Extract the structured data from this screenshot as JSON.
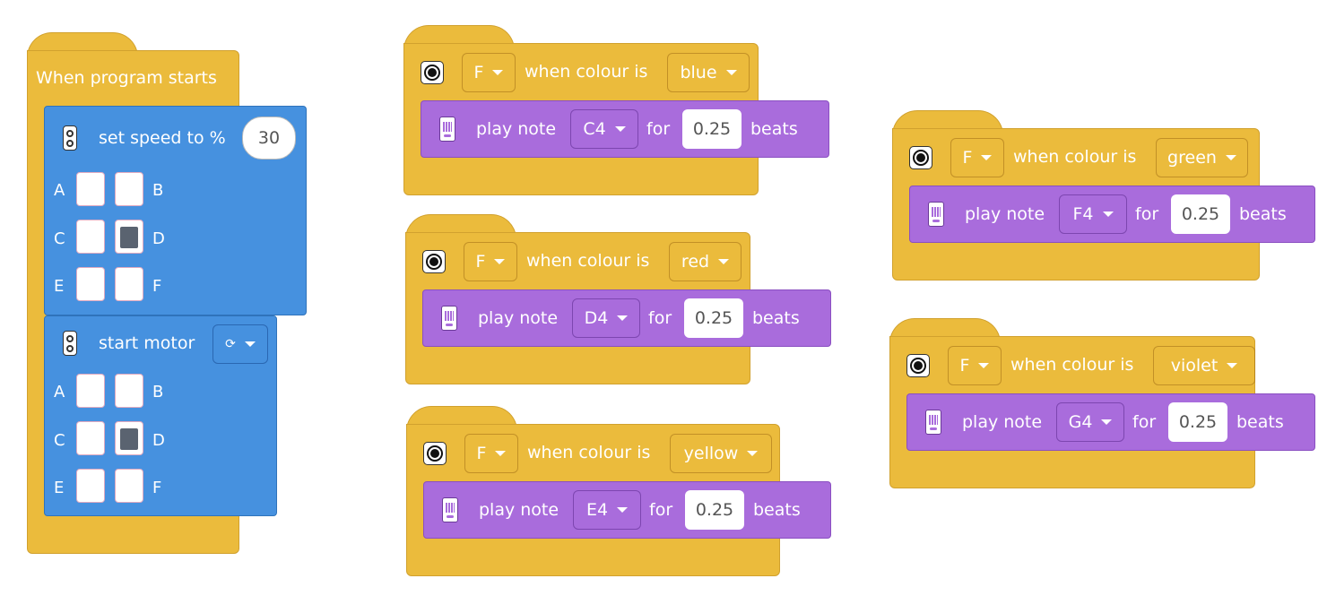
{
  "start_stack": {
    "hat_label": "When program starts",
    "set_speed": {
      "label": "set speed to %",
      "value": "30",
      "ports": [
        [
          "A",
          "B"
        ],
        [
          "C",
          "D"
        ],
        [
          "E",
          "F"
        ]
      ],
      "selected_port": "D"
    },
    "start_motor": {
      "label": "start motor",
      "direction_icon": "⟳",
      "ports": [
        [
          "A",
          "B"
        ],
        [
          "C",
          "D"
        ],
        [
          "E",
          "F"
        ]
      ],
      "selected_port": "D"
    }
  },
  "colour_stacks": [
    {
      "port": "F",
      "when_label": "when colour is",
      "colour": "blue",
      "play_label": "play note",
      "note": "C4",
      "for_label": "for",
      "beats": "0.25",
      "beats_label": "beats"
    },
    {
      "port": "F",
      "when_label": "when colour is",
      "colour": "red",
      "play_label": "play note",
      "note": "D4",
      "for_label": "for",
      "beats": "0.25",
      "beats_label": "beats"
    },
    {
      "port": "F",
      "when_label": "when colour is",
      "colour": "yellow",
      "play_label": "play note",
      "note": "E4",
      "for_label": "for",
      "beats": "0.25",
      "beats_label": "beats"
    },
    {
      "port": "F",
      "when_label": "when colour is",
      "colour": "green",
      "play_label": "play note",
      "note": "F4",
      "for_label": "for",
      "beats": "0.25",
      "beats_label": "beats"
    },
    {
      "port": "F",
      "when_label": "when colour is",
      "colour": "violet",
      "play_label": "play note",
      "note": "G4",
      "for_label": "for",
      "beats": "0.25",
      "beats_label": "beats"
    }
  ],
  "colors": {
    "event": "#ebbb3c",
    "motor": "#4691df",
    "sound": "#a96cdc"
  },
  "icons": {
    "sensor": "colour-sensor-icon",
    "motor": "motor-icon",
    "hub": "hub-icon",
    "dropdown": "chevron-down-icon"
  }
}
